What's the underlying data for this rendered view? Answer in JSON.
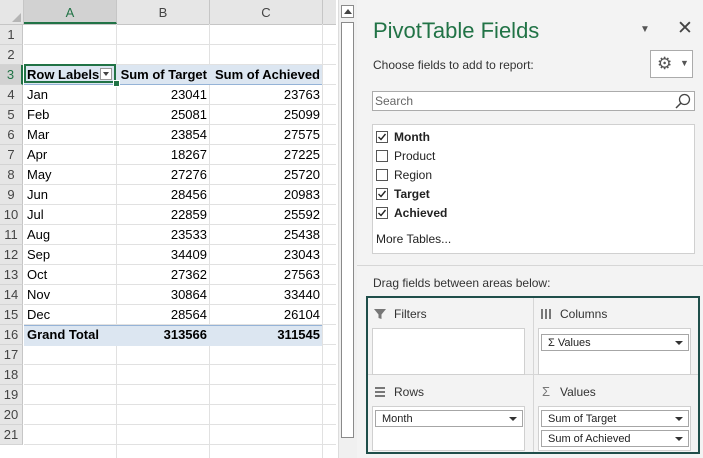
{
  "sheet": {
    "columns": [
      "A",
      "B",
      "C"
    ],
    "rows": [
      "1",
      "2",
      "3",
      "4",
      "5",
      "6",
      "7",
      "8",
      "9",
      "10",
      "11",
      "12",
      "13",
      "14",
      "15",
      "16",
      "17",
      "18",
      "19",
      "20",
      "21"
    ],
    "pivot": {
      "header": [
        "Row Labels",
        "Sum of Target",
        "Sum of Achieved"
      ],
      "data": [
        [
          "Jan",
          "23041",
          "23763"
        ],
        [
          "Feb",
          "25081",
          "25099"
        ],
        [
          "Mar",
          "23854",
          "27575"
        ],
        [
          "Apr",
          "18267",
          "27225"
        ],
        [
          "May",
          "27276",
          "25720"
        ],
        [
          "Jun",
          "28456",
          "20983"
        ],
        [
          "Jul",
          "22859",
          "25592"
        ],
        [
          "Aug",
          "23533",
          "25438"
        ],
        [
          "Sep",
          "34409",
          "23043"
        ],
        [
          "Oct",
          "27362",
          "27563"
        ],
        [
          "Nov",
          "30864",
          "33440"
        ],
        [
          "Dec",
          "28564",
          "26104"
        ]
      ],
      "total": [
        "Grand Total",
        "313566",
        "311545"
      ]
    },
    "active_cell": "A3"
  },
  "pane": {
    "title": "PivotTable Fields",
    "choose_label": "Choose fields to add to report:",
    "search_placeholder": "Search",
    "fields": [
      {
        "label": "Month",
        "checked": true
      },
      {
        "label": "Product",
        "checked": false
      },
      {
        "label": "Region",
        "checked": false
      },
      {
        "label": "Target",
        "checked": true
      },
      {
        "label": "Achieved",
        "checked": true
      }
    ],
    "more_tables": "More Tables...",
    "drag_label": "Drag fields between areas below:",
    "areas": {
      "filters": {
        "label": "Filters",
        "items": []
      },
      "columns": {
        "label": "Columns",
        "items": [
          "Σ  Values"
        ]
      },
      "rows": {
        "label": "Rows",
        "items": [
          "Month"
        ]
      },
      "values": {
        "label": "Values",
        "items": [
          "Sum of Target",
          "Sum of Achieved"
        ]
      }
    }
  },
  "colors": {
    "accent": "#217346",
    "pivot_band": "#dce6f1",
    "area_border": "#1f4e4a"
  }
}
